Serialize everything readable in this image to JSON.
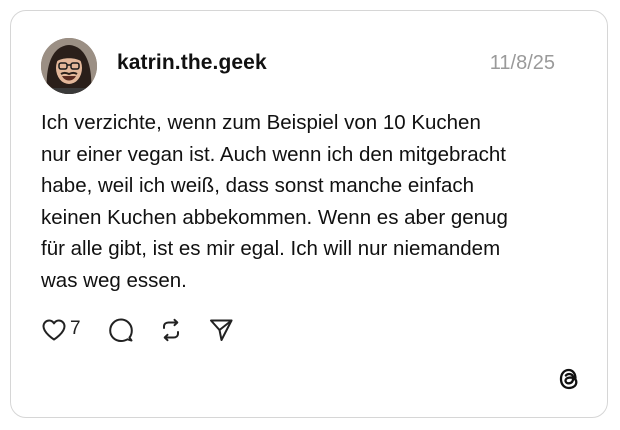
{
  "post": {
    "username": "katrin.the.geek",
    "timestamp": "11/8/25",
    "body_lines": [
      "Ich verzichte, wenn zum Beispiel von 10 Kuchen",
      "nur einer vegan ist. Auch wenn ich den mitgebracht",
      "habe, weil ich weiß, dass sonst manche einfach",
      "keinen Kuchen abbekommen. Wenn es aber genug",
      "für alle gibt, ist es mir egal. Ich will nur niemandem",
      "was weg essen."
    ]
  },
  "actions": {
    "like_count": "7",
    "icons": [
      "heart-icon",
      "comment-icon",
      "repost-icon",
      "share-icon"
    ]
  },
  "branding": {
    "logo": "threads-logo-icon"
  },
  "colors": {
    "text": "#111111",
    "muted": "#9a9a9a",
    "border": "#d6d6d6"
  }
}
